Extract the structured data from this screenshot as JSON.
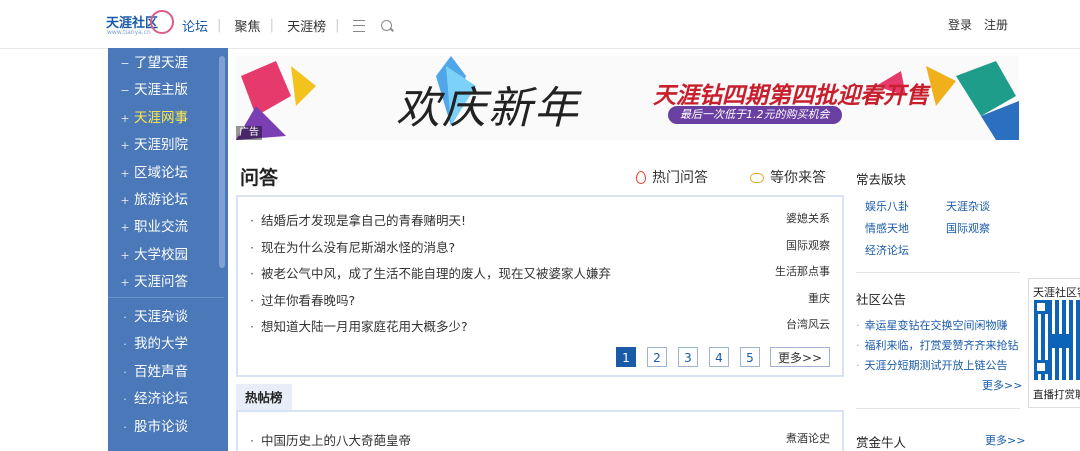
{
  "header": {
    "logo_text": "天涯社区",
    "logo_sub": "www.tianya.cn",
    "nav": [
      "论坛",
      "聚焦",
      "天涯榜"
    ],
    "login": "登录",
    "register": "注册"
  },
  "sidebar": {
    "items": [
      {
        "mark": "−",
        "label": "了望天涯"
      },
      {
        "mark": "−",
        "label": "天涯主版"
      },
      {
        "mark": "+",
        "label": "天涯网事"
      },
      {
        "mark": "+",
        "label": "天涯别院"
      },
      {
        "mark": "+",
        "label": "区域论坛"
      },
      {
        "mark": "+",
        "label": "旅游论坛"
      },
      {
        "mark": "+",
        "label": "职业交流"
      },
      {
        "mark": "+",
        "label": "大学校园"
      },
      {
        "mark": "+",
        "label": "天涯问答"
      },
      {
        "mark": "·",
        "label": "天涯杂谈"
      },
      {
        "mark": "·",
        "label": "我的大学"
      },
      {
        "mark": "·",
        "label": "百姓声音"
      },
      {
        "mark": "·",
        "label": "经济论坛"
      },
      {
        "mark": "·",
        "label": "股市论谈"
      }
    ],
    "active_index": 2
  },
  "banner": {
    "title": "欢庆新年",
    "slogan": "天涯钻四期第四批迎春开售",
    "pill": "最后一次低于1.2元的购买机会",
    "ad": "广告"
  },
  "qa": {
    "title": "问答",
    "hot_label": "热门问答",
    "wait_label": "等你来答",
    "rows": [
      {
        "q": "结婚后才发现是拿自己的青春赌明天!",
        "tag": "婆媳关系"
      },
      {
        "q": "现在为什么没有尼斯湖水怪的消息?",
        "tag": "国际观察"
      },
      {
        "q": "被老公气中风，成了生活不能自理的废人，现在又被婆家人嫌弃",
        "tag": "生活那点事"
      },
      {
        "q": "过年你看春晚吗?",
        "tag": "重庆"
      },
      {
        "q": "想知道大陆一月用家庭花用大概多少?",
        "tag": "台湾风云"
      }
    ],
    "pages": [
      "1",
      "2",
      "3",
      "4",
      "5"
    ],
    "more": "更多>>"
  },
  "hot_posts": {
    "tab": "热帖榜",
    "rows": [
      {
        "q": "中国历史上的八大奇葩皇帝",
        "tag": "煮酒论史"
      }
    ]
  },
  "right": {
    "freq_title": "常去版块",
    "freq": [
      "娱乐八卦",
      "天涯杂谈",
      "情感天地",
      "国际观察",
      "经济论坛"
    ],
    "notice_title": "社区公告",
    "notices": [
      "幸运星变钻在交换空间闲物赚",
      "福利来临，打赏爱赞齐齐来抢钻",
      "天涯分短期测试开放上链公告"
    ],
    "notice_more": "更多>>",
    "reward_title": "赏金牛人",
    "reward_more": "更多>>"
  },
  "qr": {
    "title": "天涯社区客户端",
    "caption": "直播打赏聊天"
  }
}
